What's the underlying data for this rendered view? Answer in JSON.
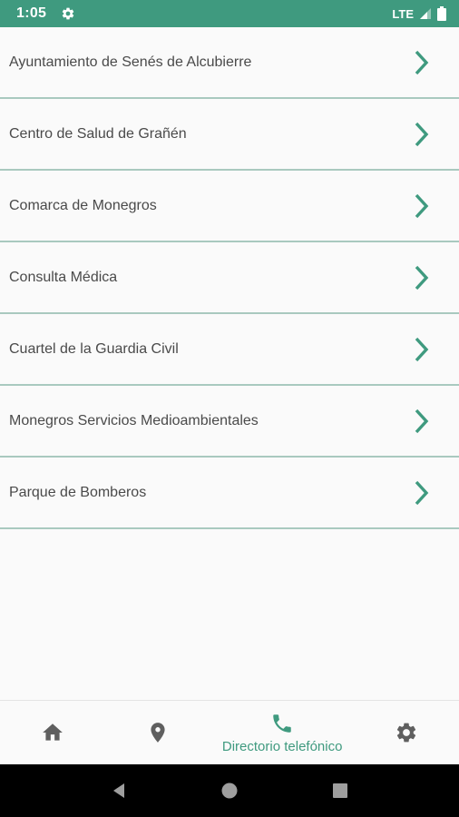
{
  "status_bar": {
    "time": "1:05",
    "network": "LTE"
  },
  "contacts": [
    {
      "label": "Ayuntamiento de Senés de Alcubierre"
    },
    {
      "label": "Centro de Salud de Grañén"
    },
    {
      "label": "Comarca de Monegros"
    },
    {
      "label": "Consulta Médica"
    },
    {
      "label": "Cuartel de la Guardia Civil"
    },
    {
      "label": "Monegros Servicios Medioambientales"
    },
    {
      "label": "Parque de Bomberos"
    }
  ],
  "bottom_nav": {
    "items": [
      {
        "icon": "home-icon"
      },
      {
        "icon": "location-pin-icon"
      },
      {
        "icon": "phone-icon",
        "label": "Directorio telefónico",
        "active": true
      },
      {
        "icon": "settings-icon"
      }
    ]
  },
  "colors": {
    "accent": "#3f9a7f",
    "divider": "#a9c9bf",
    "text": "#4a4a4a",
    "nav_icon": "#5f5f5f"
  }
}
